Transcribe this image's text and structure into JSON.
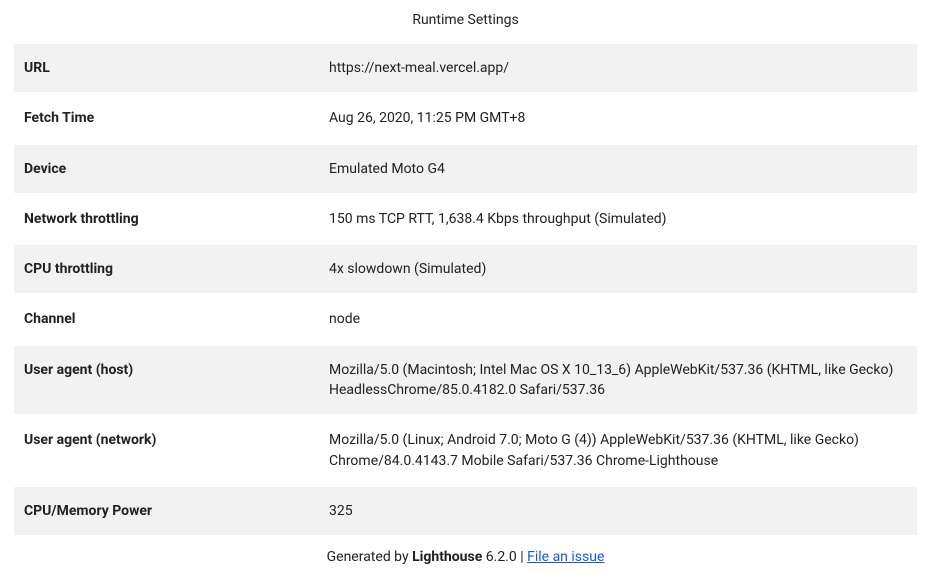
{
  "title": "Runtime Settings",
  "rows": [
    {
      "label": "URL",
      "value": "https://next-meal.vercel.app/"
    },
    {
      "label": "Fetch Time",
      "value": "Aug 26, 2020, 11:25 PM GMT+8"
    },
    {
      "label": "Device",
      "value": "Emulated Moto G4"
    },
    {
      "label": "Network throttling",
      "value": "150 ms TCP RTT, 1,638.4 Kbps throughput (Simulated)"
    },
    {
      "label": "CPU throttling",
      "value": "4x slowdown (Simulated)"
    },
    {
      "label": "Channel",
      "value": "node"
    },
    {
      "label": "User agent (host)",
      "value": "Mozilla/5.0 (Macintosh; Intel Mac OS X 10_13_6) AppleWebKit/537.36 (KHTML, like Gecko) HeadlessChrome/85.0.4182.0 Safari/537.36"
    },
    {
      "label": "User agent (network)",
      "value": "Mozilla/5.0 (Linux; Android 7.0; Moto G (4)) AppleWebKit/537.36 (KHTML, like Gecko) Chrome/84.0.4143.7 Mobile Safari/537.36 Chrome-Lighthouse"
    },
    {
      "label": "CPU/Memory Power",
      "value": "325"
    }
  ],
  "footer": {
    "generated_prefix": "Generated by ",
    "product": "Lighthouse",
    "version": " 6.2.0",
    "separator": " | ",
    "link_text": "File an issue"
  }
}
